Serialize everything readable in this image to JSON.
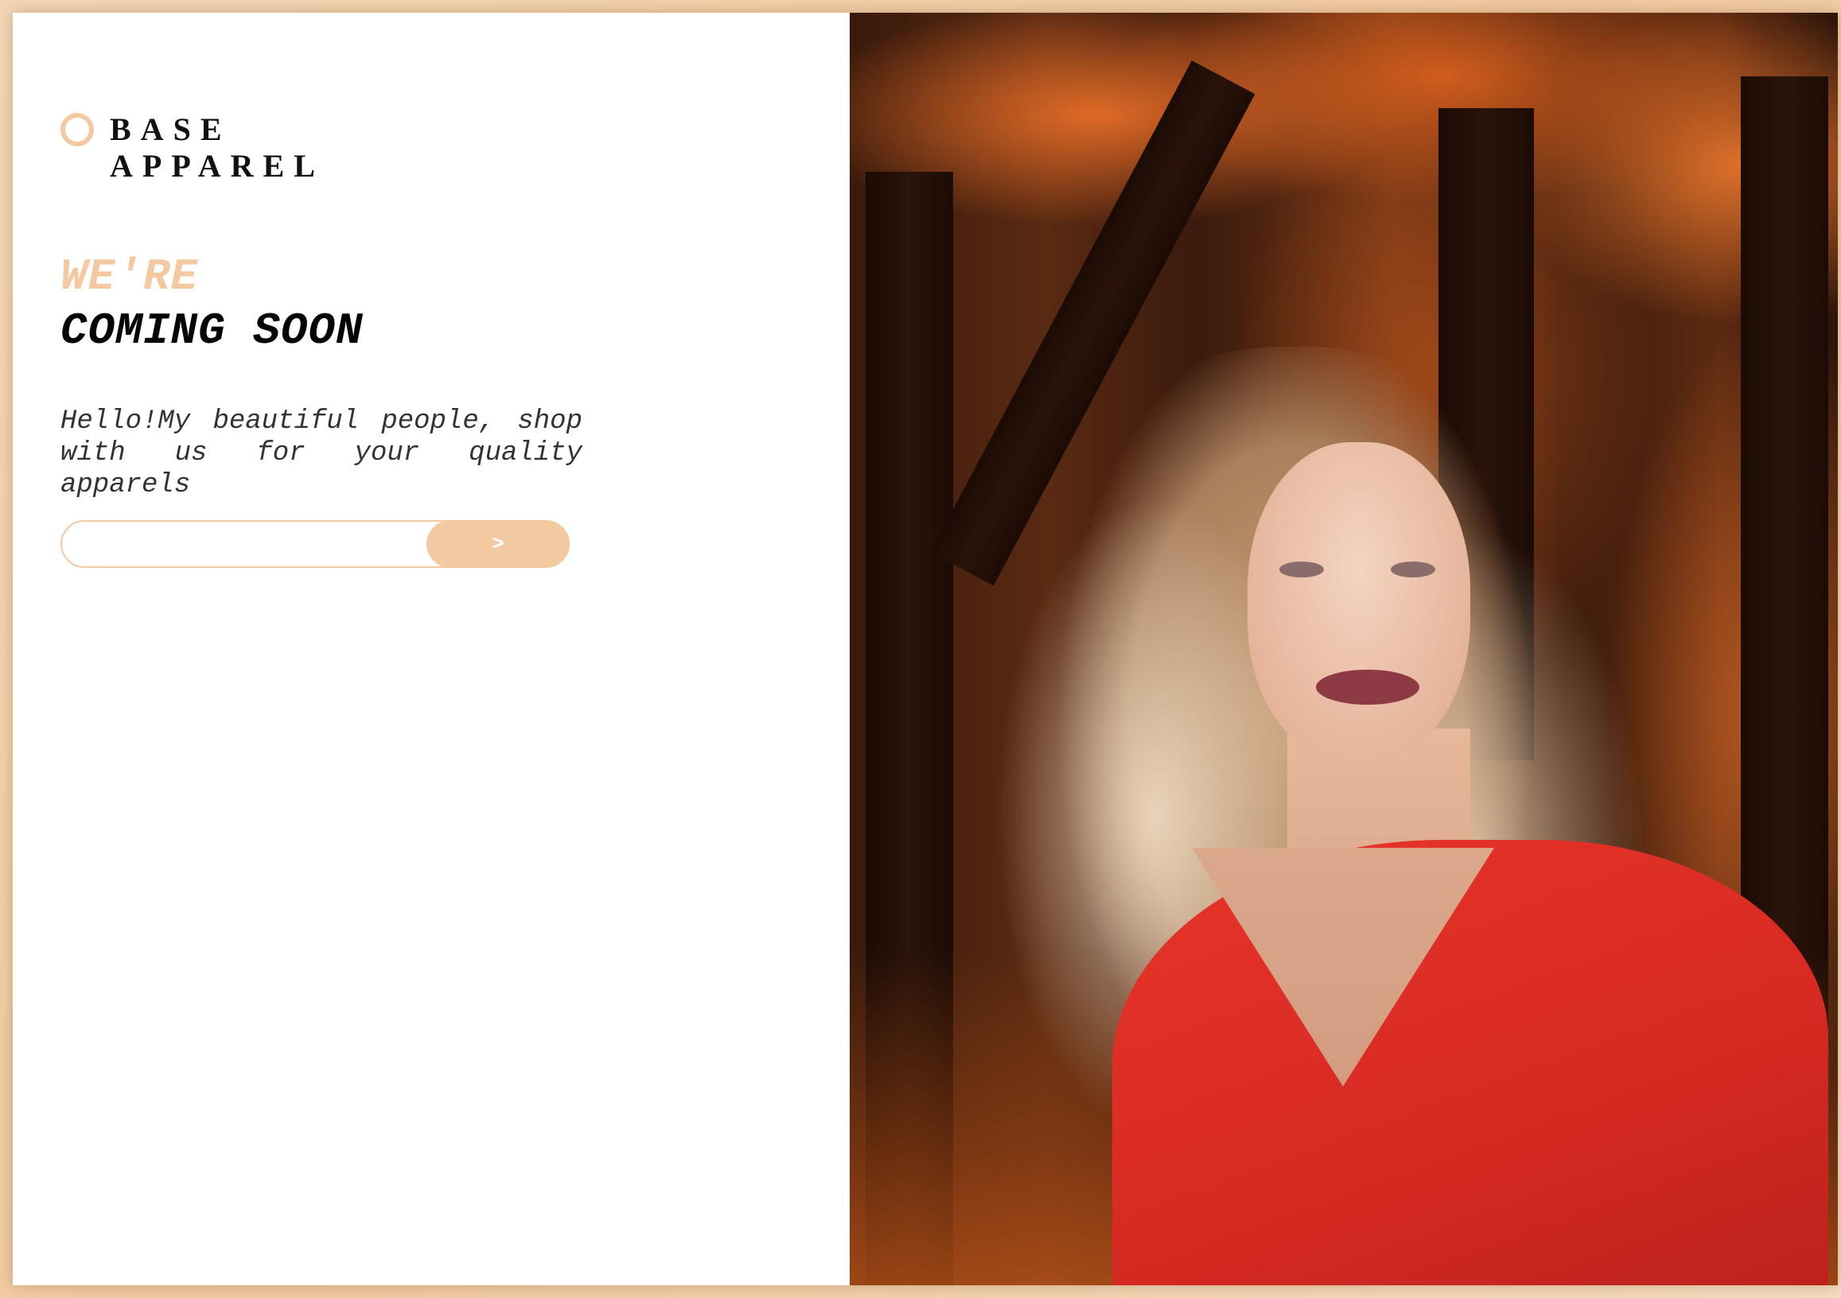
{
  "brand": {
    "line1": "BASE",
    "line2": "APPAREL",
    "icon": "circle-outline-icon",
    "accent_color": "#f2c9a0"
  },
  "hero": {
    "headline_top": "WE'RE",
    "headline_bottom": "COMING SOON",
    "intro": "Hello!My  beautiful  people, shop with us for your quality apparels"
  },
  "subscribe": {
    "email_value": "",
    "submit_label": ">"
  },
  "image": {
    "subject": "woman-in-red-sweater-autumn-photo"
  }
}
